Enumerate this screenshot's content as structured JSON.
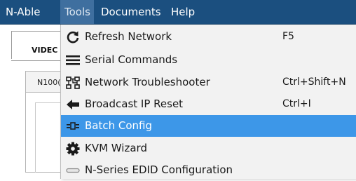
{
  "menubar": {
    "items": [
      {
        "label": "N-Able"
      },
      {
        "label": "Tools"
      },
      {
        "label": "Documents"
      },
      {
        "label": "Help"
      }
    ],
    "active_index": 1,
    "background_color": "#1b4f7f"
  },
  "background_window": {
    "outer_tab_label": "VIDEC",
    "inner_tab_label": "N100("
  },
  "tools_menu": {
    "highlight_color": "#3d97e8",
    "items": [
      {
        "label": "Refresh Network",
        "shortcut": "F5",
        "icon": "refresh-icon"
      },
      {
        "label": "Serial Commands",
        "shortcut": "",
        "icon": "hamburger-lines-icon"
      },
      {
        "label": "Network Troubleshooter",
        "shortcut": "Ctrl+Shift+N",
        "icon": "network-icon"
      },
      {
        "label": "Broadcast IP Reset",
        "shortcut": "Ctrl+I",
        "icon": "back-arrow-icon"
      },
      {
        "label": "Batch Config",
        "shortcut": "",
        "icon": "batch-config-icon",
        "highlighted": true
      },
      {
        "label": "KVM Wizard",
        "shortcut": "",
        "icon": "gear-icon"
      },
      {
        "label": "N-Series EDID Configuration",
        "shortcut": "",
        "icon": "edid-connector-icon"
      }
    ]
  }
}
